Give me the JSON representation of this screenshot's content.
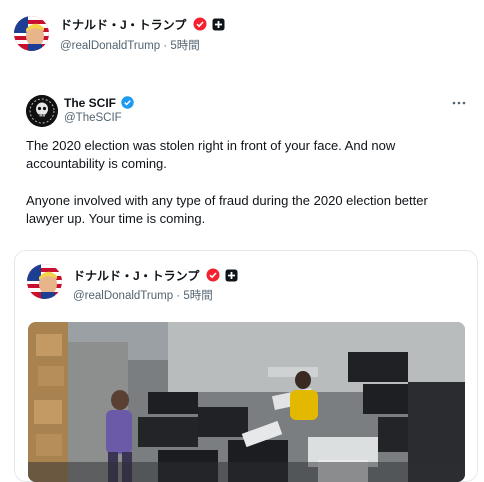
{
  "outer_post": {
    "author_name": "ドナルド・J・トランプ",
    "handle": "@realDonaldTrump",
    "separator": "·",
    "time": "5時間"
  },
  "quoted_post": {
    "author_name": "The SCIF",
    "handle": "@TheSCIF",
    "more_icon": "more-horizontal-icon",
    "paragraph1": "The 2020 election was stolen right in front of your face. And now accountability is coming.",
    "paragraph2": "Anyone involved with any type of fraud during the 2020 election better lawyer up. Your time is coming."
  },
  "nested_post": {
    "author_name": "ドナルド・J・トランプ",
    "handle": "@realDonaldTrump",
    "separator": "·",
    "time": "5時間"
  },
  "colors": {
    "verified_blue": "#1d9bf0",
    "affiliate_red": "#f4212e",
    "text_secondary": "#536471"
  }
}
